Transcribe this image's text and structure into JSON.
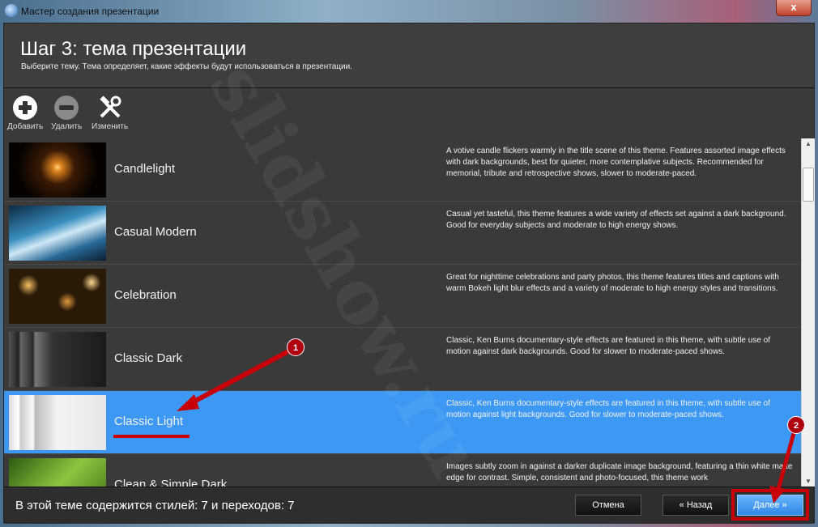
{
  "window": {
    "title": "Мастер создания презентации",
    "close": "x"
  },
  "header": {
    "title": "Шаг 3: тема презентации",
    "subtitle": "Выберите тему. Тема определяет, какие эффекты будут использоваться в презентации."
  },
  "toolbar": {
    "add": "Добавить",
    "remove": "Удалить",
    "edit": "Изменить"
  },
  "themes": [
    {
      "name": "Candlelight",
      "desc": "A votive candle flickers warmly in the title scene of this theme. Features assorted image effects with dark backgrounds, best for quieter, more contemplative subjects. Recommended for memorial, tribute and retrospective shows, slower to moderate-paced."
    },
    {
      "name": "Casual Modern",
      "desc": "Casual yet tasteful, this theme features a wide variety of effects set against a dark background. Good for everyday subjects and moderate to high energy shows."
    },
    {
      "name": "Celebration",
      "desc": "Great for nighttime celebrations and party photos, this theme features titles and captions with warm Bokeh light blur effects and a variety of moderate to high energy styles and transitions."
    },
    {
      "name": "Classic Dark",
      "desc": "Classic, Ken Burns documentary-style effects are featured in this theme, with subtle use of motion against dark backgrounds. Good for slower to moderate-paced shows."
    },
    {
      "name": "Classic Light",
      "desc": "Classic, Ken Burns documentary-style effects are featured in this theme, with subtle use of motion against light backgrounds. Good for slower to moderate-paced shows.",
      "selected": true
    },
    {
      "name": "Clean & Simple Dark",
      "desc": "Images subtly zoom in against a darker duplicate image background, featuring a thin white matte edge for contrast. Simple, consistent and photo-focused, this theme work"
    }
  ],
  "footer": {
    "info": "В этой теме содержится стилей: 7 и переходов: 7",
    "cancel": "Отмена",
    "back": "« Назад",
    "next": "Далее »"
  },
  "annotations": {
    "badge1": "1",
    "badge2": "2",
    "color": "#c8000a"
  },
  "watermark": "slidshow.ru",
  "colors": {
    "selection": "#3d98f3",
    "panel": "#3b3b3b"
  }
}
